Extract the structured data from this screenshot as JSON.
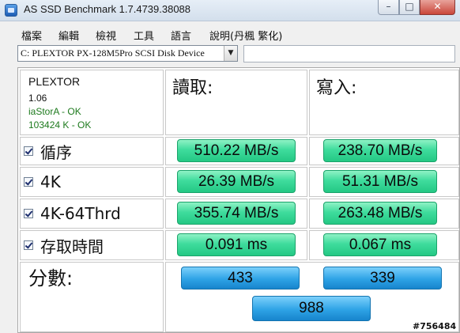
{
  "window": {
    "title": "AS SSD Benchmark 1.7.4739.38088",
    "controls": {
      "minimize": "–",
      "maximize": "□",
      "close": "✕"
    }
  },
  "menu": [
    "檔案",
    "編輯",
    "檢視",
    "工具",
    "語言",
    "說明(丹楓 繁化)"
  ],
  "device": {
    "selected": "C: PLEXTOR PX-128M5Pro SCSI Disk Device",
    "extra_value": ""
  },
  "info": {
    "name": "PLEXTOR",
    "firmware": "1.06",
    "driver": "iaStorA - OK",
    "alignment": "103424 K - OK"
  },
  "columns": {
    "read": "讀取:",
    "write": "寫入:"
  },
  "rows": [
    {
      "label": "循序",
      "checked": true,
      "read": "510.22 MB/s",
      "write": "238.70 MB/s"
    },
    {
      "label": "4K",
      "checked": true,
      "read": "26.39 MB/s",
      "write": "51.31 MB/s"
    },
    {
      "label": "4K-64Thrd",
      "checked": true,
      "read": "355.74 MB/s",
      "write": "263.48 MB/s"
    },
    {
      "label": "存取時間",
      "checked": true,
      "read": "0.091 ms",
      "write": "0.067 ms"
    }
  ],
  "score": {
    "label": "分數:",
    "read": "433",
    "write": "339",
    "total": "988"
  },
  "watermark": "#756484",
  "colors": {
    "result_green": "#3fdc9d",
    "score_blue": "#2ea3e6",
    "status_ok": "#1d7a1d"
  }
}
